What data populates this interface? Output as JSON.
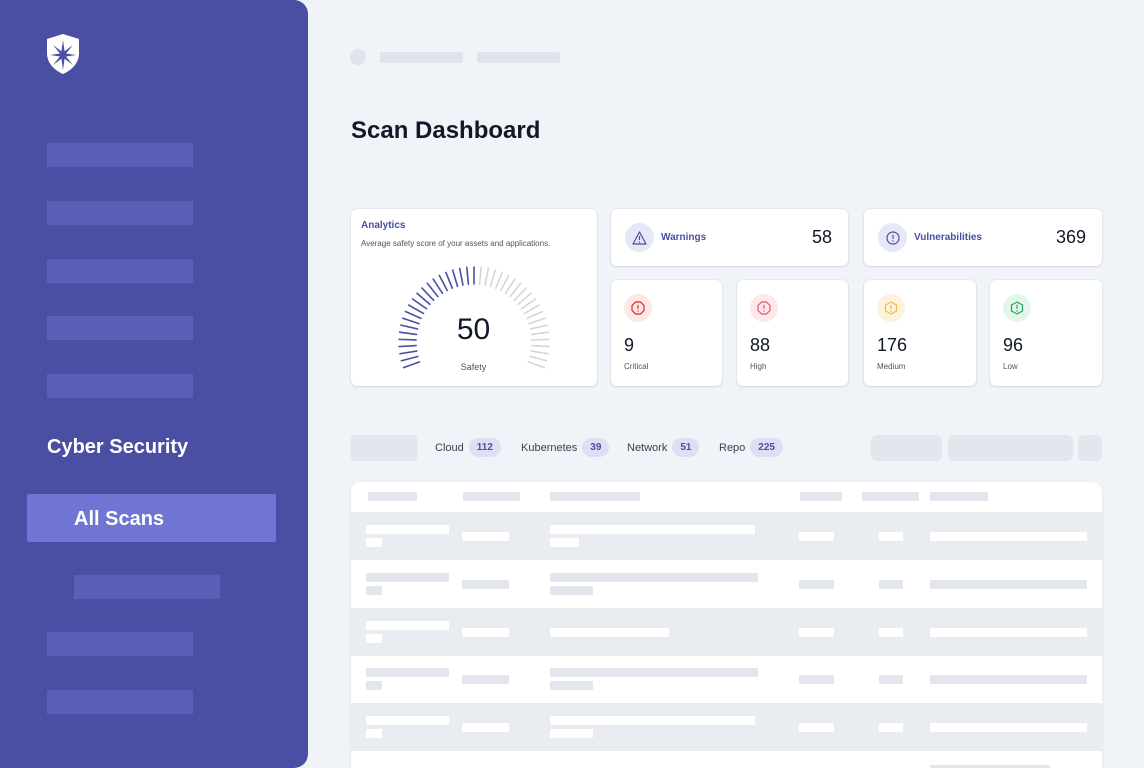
{
  "page": {
    "title": "Scan Dashboard"
  },
  "sidebar": {
    "section_title": "Cyber Security",
    "active_item": "All Scans"
  },
  "analytics": {
    "title": "Analytics",
    "description": "Average safety score of your assets and applications.",
    "score": "50",
    "score_label": "Safety",
    "score_fraction": 0.5
  },
  "stats": {
    "warnings": {
      "label": "Warnings",
      "value": "58",
      "icon": "warning-triangle-icon"
    },
    "vulnerabilities": {
      "label": "Vulnerabilities",
      "value": "369",
      "icon": "alert-circle-icon"
    }
  },
  "severity": [
    {
      "value": "9",
      "label": "Critical",
      "color": "#dc2626",
      "bg": "#fde8e8",
      "icon": "critical-octagon-icon"
    },
    {
      "value": "88",
      "label": "High",
      "color": "#e0566b",
      "bg": "#fde7ea",
      "icon": "high-octagon-icon"
    },
    {
      "value": "176",
      "label": "Medium",
      "color": "#f0b64a",
      "bg": "#fdf3dd",
      "icon": "medium-hexagon-icon"
    },
    {
      "value": "96",
      "label": "Low",
      "color": "#22a55a",
      "bg": "#e2f6ea",
      "icon": "low-hexagon-icon"
    }
  ],
  "filters": [
    {
      "label": "Cloud",
      "count": "112"
    },
    {
      "label": "Kubernetes",
      "count": "39"
    },
    {
      "label": "Network",
      "count": "51"
    },
    {
      "label": "Repo",
      "count": "225"
    }
  ],
  "colors": {
    "sidebar": "#4a4fa3",
    "sidebar_active": "#7075d3",
    "accent": "#4a4fa3",
    "background": "#f0f3f8"
  }
}
